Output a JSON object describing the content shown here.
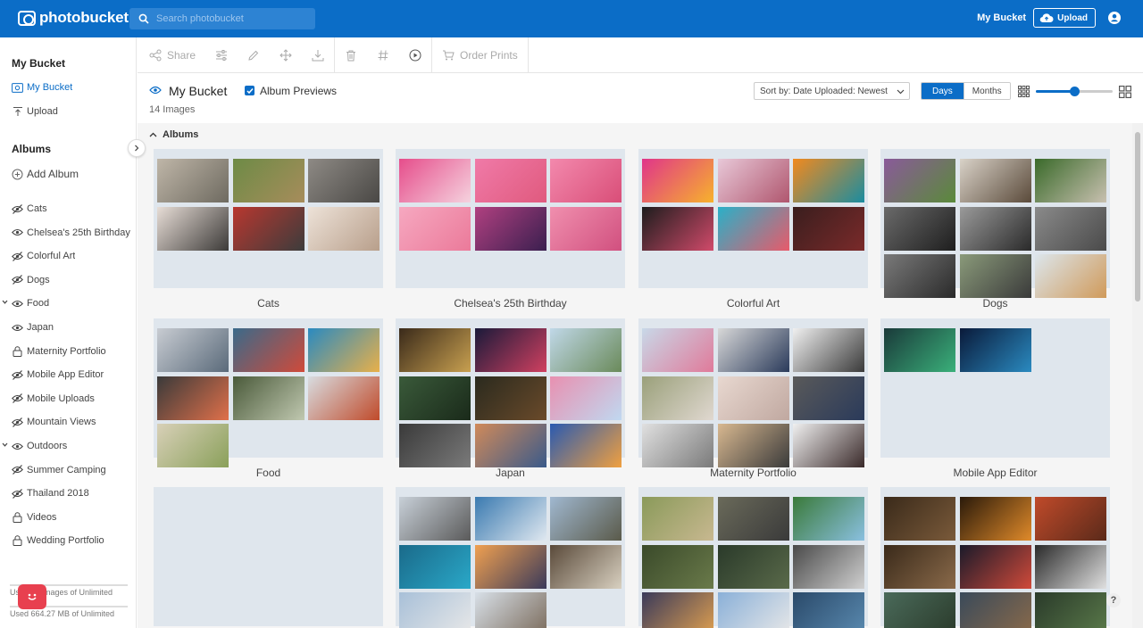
{
  "header": {
    "brand": "photobucket",
    "search_placeholder": "Search photobucket",
    "my_bucket": "My Bucket",
    "upload": "Upload"
  },
  "sidebar": {
    "my_bucket_heading": "My Bucket",
    "nav": [
      {
        "label": "My Bucket",
        "icon": "image-icon",
        "active": true
      },
      {
        "label": "Upload",
        "icon": "upload-icon",
        "active": false
      }
    ],
    "albums_heading": "Albums",
    "add_album": "Add Album",
    "albums": [
      {
        "label": "Cats",
        "icon": "eye-slash-icon",
        "expandable": false
      },
      {
        "label": "Chelsea's 25th Birthday",
        "icon": "eye-icon",
        "expandable": false
      },
      {
        "label": "Colorful Art",
        "icon": "eye-slash-icon",
        "expandable": false
      },
      {
        "label": "Dogs",
        "icon": "eye-slash-icon",
        "expandable": false
      },
      {
        "label": "Food",
        "icon": "eye-icon",
        "expandable": true
      },
      {
        "label": "Japan",
        "icon": "eye-icon",
        "expandable": false
      },
      {
        "label": "Maternity Portfolio",
        "icon": "lock-icon",
        "expandable": false
      },
      {
        "label": "Mobile App Editor",
        "icon": "eye-slash-icon",
        "expandable": false
      },
      {
        "label": "Mobile Uploads",
        "icon": "eye-slash-icon",
        "expandable": false
      },
      {
        "label": "Mountain Views",
        "icon": "eye-slash-icon",
        "expandable": false
      },
      {
        "label": "Outdoors",
        "icon": "eye-icon",
        "expandable": true
      },
      {
        "label": "Summer Camping",
        "icon": "eye-slash-icon",
        "expandable": false
      },
      {
        "label": "Thailand 2018",
        "icon": "eye-slash-icon",
        "expandable": false
      },
      {
        "label": "Videos",
        "icon": "lock-icon",
        "expandable": false
      },
      {
        "label": "Wedding Portfolio",
        "icon": "lock-icon",
        "expandable": false
      }
    ],
    "usage_images": "Used 14 images of Unlimited",
    "usage_storage": "Used 664.27 MB of Unlimited"
  },
  "toolbar": {
    "share": "Share",
    "order_prints": "Order Prints"
  },
  "page": {
    "title": "My Bucket",
    "album_previews": "Album Previews",
    "album_previews_checked": true,
    "image_count": "14 Images",
    "sort": "Sort by: Date Uploaded: Newest",
    "view_days": "Days",
    "view_months": "Months",
    "thumbnail_size_fraction": 0.5,
    "section_title": "Albums"
  },
  "colors": {
    "brand_blue": "#0b6dc7",
    "album_bg": "#dfe6ed"
  },
  "albums": [
    {
      "name": "Cats",
      "thumbs": [
        [
          "#bfb6a8",
          "#6e6a60"
        ],
        [
          "#6d8b46",
          "#a78c5b"
        ],
        [
          "#8e8a85",
          "#4a4845"
        ],
        [
          "#e7ddd6",
          "#3c3a38"
        ],
        [
          "#b8372f",
          "#3c3c3c"
        ],
        [
          "#ede2d8",
          "#b89f8b"
        ]
      ]
    },
    {
      "name": "Chelsea's 25th Birthday",
      "thumbs": [
        [
          "#e64d8b",
          "#f5d2de"
        ],
        [
          "#f07aa8",
          "#e05a7e"
        ],
        [
          "#f389ad",
          "#d94e78"
        ],
        [
          "#f6a8c0",
          "#eb7a9a"
        ],
        [
          "#b04080",
          "#3a1f4f"
        ],
        [
          "#f08fae",
          "#d1507f"
        ]
      ]
    },
    {
      "name": "Colorful Art",
      "thumbs": [
        [
          "#e0358a",
          "#f7b22c"
        ],
        [
          "#e8c8d8",
          "#b0566e"
        ],
        [
          "#f28a1e",
          "#1a8ca0"
        ],
        [
          "#1d1d1d",
          "#d14a6a"
        ],
        [
          "#2ab0c8",
          "#e85a6a"
        ],
        [
          "#3a1e1e",
          "#7a2a2a"
        ]
      ]
    },
    {
      "name": "Dogs",
      "thumbs": [
        [
          "#8a5a9a",
          "#5a8a3a"
        ],
        [
          "#d9d2c8",
          "#5a4a3a"
        ],
        [
          "#3a6a2a",
          "#c8c0b0"
        ],
        [
          "#6a6a6a",
          "#1e1e1e"
        ],
        [
          "#9a9a9a",
          "#2a2a2a"
        ],
        [
          "#8a8a8a",
          "#4a4a4a"
        ],
        [
          "#7a7a7a",
          "#2a2a2a"
        ],
        [
          "#8a9a7a",
          "#3a3a3a"
        ],
        [
          "#dce6ec",
          "#d09a5a"
        ]
      ]
    },
    {
      "name": "Food",
      "thumbs": [
        [
          "#c8ccd2",
          "#5a6a7a"
        ],
        [
          "#3a6a8a",
          "#d04a3a"
        ],
        [
          "#2a8ac0",
          "#e8b04a"
        ],
        [
          "#3a3a3a",
          "#e0704a"
        ],
        [
          "#4a5a3a",
          "#c0c8b0"
        ],
        [
          "#d8dce0",
          "#c04a2a"
        ],
        [
          "#d8d0b8",
          "#8aa05a"
        ]
      ]
    },
    {
      "name": "Japan",
      "thumbs": [
        [
          "#3a2a1a",
          "#c8a050"
        ],
        [
          "#1a1a3a",
          "#d04060"
        ],
        [
          "#c0d8e8",
          "#6a8a5a"
        ],
        [
          "#3a5a3a",
          "#1a2a1a"
        ],
        [
          "#2a2a1e",
          "#6a4a2a"
        ],
        [
          "#e890b0",
          "#c0d8f0"
        ],
        [
          "#3a3a3a",
          "#7a7a7a"
        ],
        [
          "#d08a5a",
          "#3a5a8a"
        ],
        [
          "#2a5ab0",
          "#f0a040"
        ]
      ]
    },
    {
      "name": "Maternity Portfolio",
      "thumbs": [
        [
          "#c8d8e8",
          "#e07a9a"
        ],
        [
          "#d8d8d8",
          "#2a3a5a"
        ],
        [
          "#f0f0f0",
          "#3a3a3a"
        ],
        [
          "#9aa07a",
          "#e0d8d0"
        ],
        [
          "#e8d8d0",
          "#c0a8a0"
        ],
        [
          "#5a5a5a",
          "#2a3a5a"
        ],
        [
          "#e0e0e0",
          "#7a7a7a"
        ],
        [
          "#d8b890",
          "#3a3a3a"
        ],
        [
          "#f0f0f0",
          "#3a2a2a"
        ]
      ]
    },
    {
      "name": "Mobile App Editor",
      "thumbs": [
        [
          "#1a3a3a",
          "#3ab07a"
        ],
        [
          "#0a1a3a",
          "#2a8ac0"
        ]
      ]
    },
    {
      "name": "",
      "thumbs": []
    },
    {
      "name": "",
      "thumbs": [
        [
          "#c8d0d8",
          "#5a5a5a"
        ],
        [
          "#3a7ab0",
          "#e0e8f0"
        ],
        [
          "#a0b8d0",
          "#5a5a4a"
        ],
        [
          "#1a6a8a",
          "#2aa8c8"
        ],
        [
          "#f0a050",
          "#3a3a5a"
        ],
        [
          "#5a4a3a",
          "#d8d0c0"
        ],
        [
          "#a8c0d8",
          "#e8e8e8"
        ],
        [
          "#d8e0e8",
          "#7a6a5a"
        ]
      ]
    },
    {
      "name": "",
      "thumbs": [
        [
          "#8a9a5a",
          "#c8b890"
        ],
        [
          "#6a6a5a",
          "#3a3a3a"
        ],
        [
          "#3a7a3a",
          "#8ac0e0"
        ],
        [
          "#3a4a2a",
          "#6a7a4a"
        ],
        [
          "#2a3a2a",
          "#5a6a4a"
        ],
        [
          "#4a4a4a",
          "#d0d0d0"
        ],
        [
          "#3a3a5a",
          "#e0a050"
        ],
        [
          "#8ab0d8",
          "#e8e8e8"
        ],
        [
          "#2a4a6a",
          "#5a8ab0"
        ]
      ]
    },
    {
      "name": "",
      "thumbs": [
        [
          "#3a2a1a",
          "#7a5a3a"
        ],
        [
          "#2a1a0a",
          "#e08a2a"
        ],
        [
          "#c04a2a",
          "#5a2a1a"
        ],
        [
          "#3a2a1a",
          "#8a6a4a"
        ],
        [
          "#1a1a2a",
          "#d04a3a"
        ],
        [
          "#2a2a2a",
          "#e0e0e0"
        ],
        [
          "#4a6a5a",
          "#2a3a2a"
        ],
        [
          "#3a4a5a",
          "#8a6a4a"
        ],
        [
          "#2a3a2a",
          "#5a7a4a"
        ]
      ]
    }
  ]
}
